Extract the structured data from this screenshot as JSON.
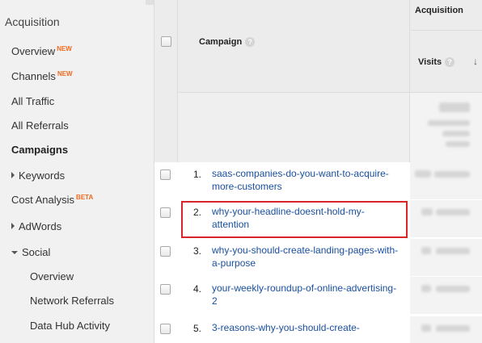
{
  "sidebar": {
    "heading": "Acquisition",
    "items": [
      {
        "label": "Overview",
        "badge": "NEW"
      },
      {
        "label": "Channels",
        "badge": "NEW"
      },
      {
        "label": "All Traffic"
      },
      {
        "label": "All Referrals"
      },
      {
        "label": "Campaigns"
      },
      {
        "label": "Keywords"
      },
      {
        "label": "Cost Analysis",
        "badge": "BETA"
      },
      {
        "label": "AdWords"
      },
      {
        "label": "Social"
      },
      {
        "label": "Overview"
      },
      {
        "label": "Network Referrals"
      },
      {
        "label": "Data Hub Activity"
      }
    ]
  },
  "table": {
    "campaign_header": "Campaign",
    "group_header": "Acquisition",
    "visits_header": "Visits",
    "help_glyph": "?",
    "sort_glyph": "↓",
    "rows": [
      {
        "num": "1.",
        "campaign": "saas-companies-do-you-want-to-acquire-more-customers"
      },
      {
        "num": "2.",
        "campaign": "why-your-headline-doesnt-hold-my-attention"
      },
      {
        "num": "3.",
        "campaign": "why-you-should-create-landing-pages-with-a-purpose"
      },
      {
        "num": "4.",
        "campaign": "your-weekly-roundup-of-online-advertising-2"
      },
      {
        "num": "5.",
        "campaign": "3-reasons-why-you-should-create-"
      }
    ]
  },
  "colors": {
    "link": "#1a4fa0",
    "badge": "#f06a1e",
    "highlight": "#d8252b"
  }
}
